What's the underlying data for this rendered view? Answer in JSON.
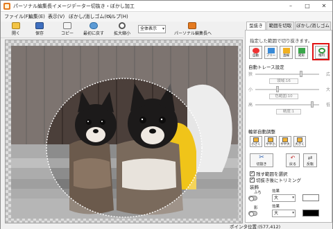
{
  "window": {
    "title": "パーソナル編集長イメージデーター切抜き・ぼかし加工"
  },
  "window_controls": {
    "minimize": "–",
    "maximize": "□",
    "close": "✕"
  },
  "menu": [
    "ファイル(F)",
    "編集(E)",
    "表示(V)",
    "ぼかし/消しゴム(U)",
    "ヘルプ(H)"
  ],
  "toolbar": {
    "open": "開く",
    "save": "保存",
    "copy": "コピー",
    "revert": "最初に戻す",
    "zoom": "拡大縮小",
    "zoom_value": "全体表示",
    "send": "パーソナル編集長へ"
  },
  "tabs": [
    "型抜き",
    "範囲を切取",
    "ぼかし/消しゴム"
  ],
  "panel": {
    "instruction": "指定した範囲で切り抜きます。",
    "modes": [
      "自動",
      "フリー",
      "直線",
      "矩形",
      "楕円"
    ],
    "auto_trace_label": "自動トレース設定",
    "sliders": [
      {
        "lo": "狭",
        "hi": "広",
        "value_label": "領域:16"
      },
      {
        "lo": "小",
        "hi": "大",
        "value_label": "色範囲:10"
      },
      {
        "lo": "高",
        "hi": "低",
        "value_label": "精度:1"
      }
    ],
    "range_adjust_label": "輪郭自動調整",
    "adjust_buttons": [
      "小さく",
      "やや小",
      "やや大",
      "大きく"
    ],
    "cut_button": "切抜き",
    "cancel_button": "戻る",
    "reverse_button": "反転",
    "check_keep": "残す範囲を選択",
    "check_trim": "切抜き後にトリミング",
    "effect_label": "装飾",
    "shadow_label": "ふち",
    "shadow_size": "大",
    "glow_label": "影",
    "effect2_label": "効果",
    "effect2_size": "大",
    "swatch_colors": [
      "#ffffff",
      "#000000"
    ]
  },
  "status": {
    "position": "ポインタ位置:(577,412)"
  },
  "colors": {
    "highlight": "#e01010",
    "accent_orange": "#e57a1f",
    "selection_stroke": "#ffffff"
  },
  "icons": [
    "app-icon",
    "folder-open-icon",
    "save-disk-icon",
    "copy-icon",
    "undo-icon",
    "magnifier-icon",
    "send-arrow-icon",
    "magic-wand-icon",
    "lasso-icon",
    "line-icon",
    "rectangle-icon",
    "ellipse-icon",
    "scissors-icon",
    "back-arrow-icon",
    "reverse-icon"
  ]
}
